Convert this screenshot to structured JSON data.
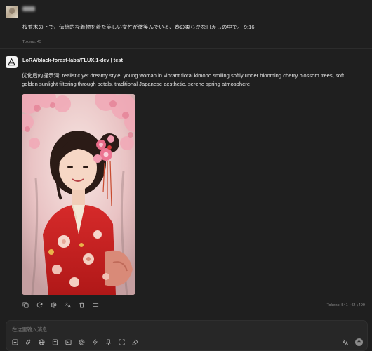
{
  "user_message": {
    "text": "桜並木の下で、伝統的な着物を着た美しい女性が微笑んでいる、春の柔らかな日差しの中で。 9:16",
    "tokens": "Tokens: 45"
  },
  "response": {
    "model_name": "LoRA/black-forest-labs/FLUX.1-dev | test",
    "prompt": "优化后的提示词: realistic yet dreamy style, young woman in vibrant floral kimono smiling softly under blooming cherry blossom trees, soft golden sunlight filtering through petals, traditional Japanese aesthetic, serene spring atmosphere",
    "tokens": "Tokens: 541 ↑42 ↓499"
  },
  "input": {
    "placeholder": "在这里输入消息..."
  }
}
